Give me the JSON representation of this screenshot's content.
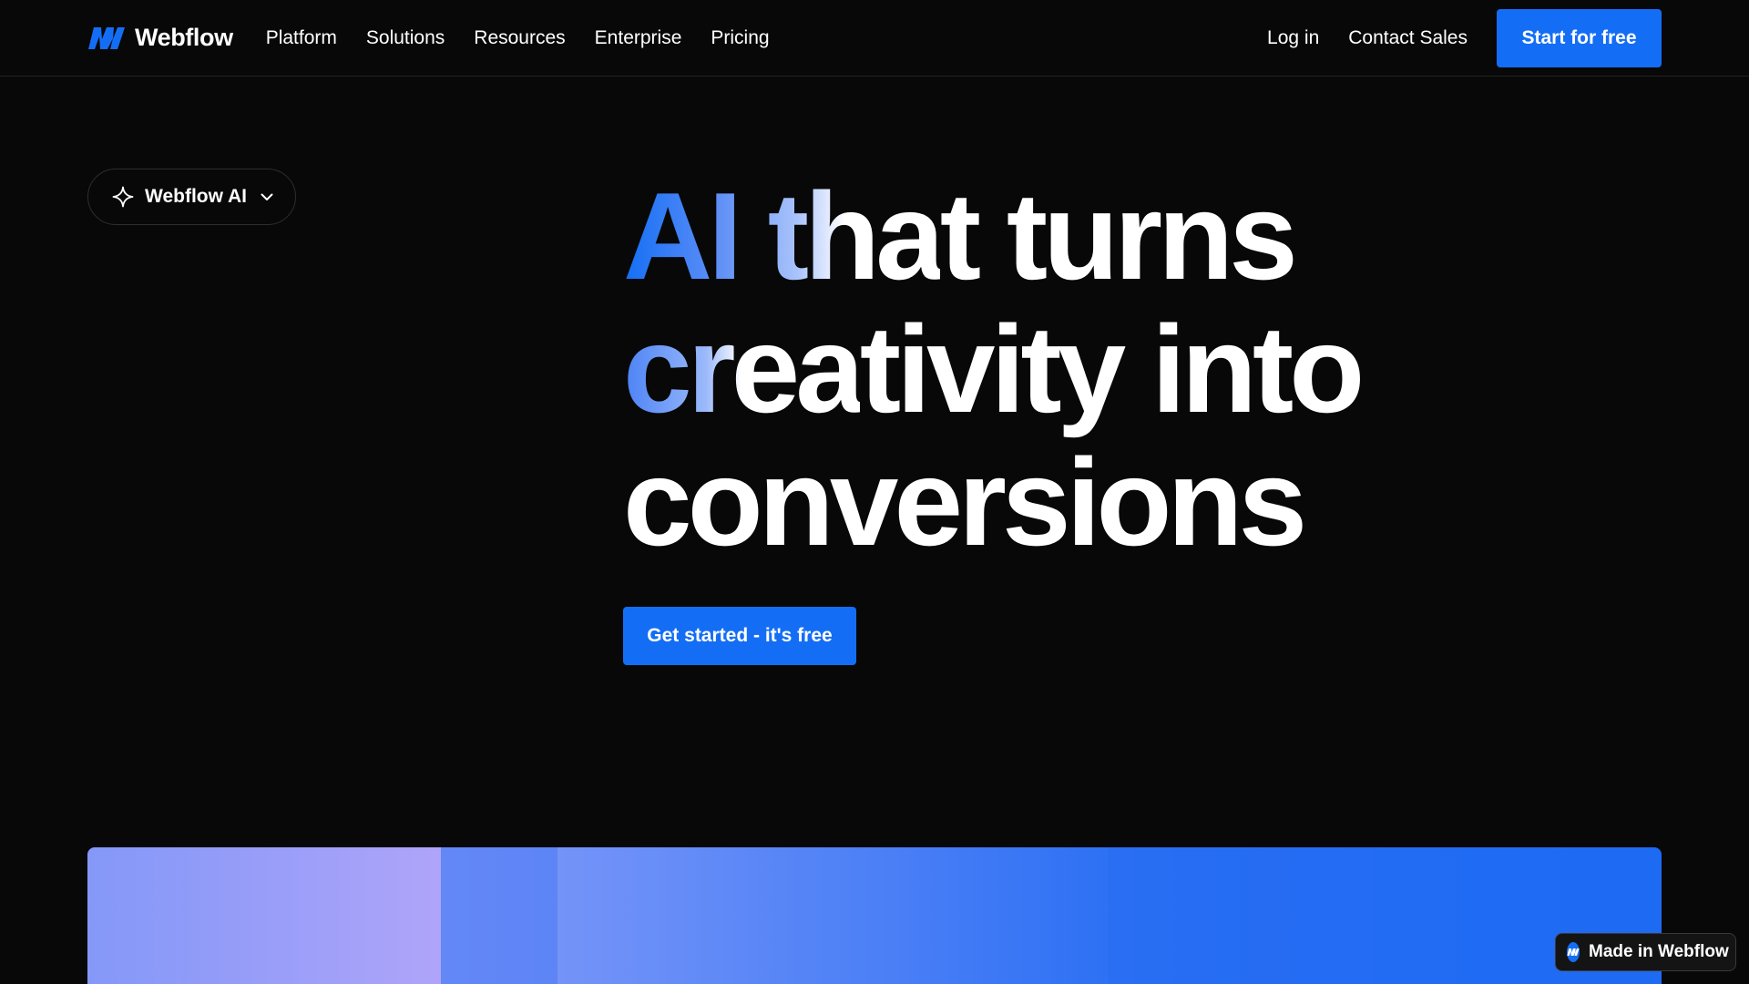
{
  "nav": {
    "brand": "Webflow",
    "links": [
      "Platform",
      "Solutions",
      "Resources",
      "Enterprise",
      "Pricing"
    ],
    "login": "Log in",
    "contact": "Contact Sales",
    "cta": "Start for free"
  },
  "ai_menu": {
    "label": "Webflow AI"
  },
  "hero": {
    "line1_gradient": "AI tha",
    "line1_rest": "t turns",
    "line2_gradient": "crea",
    "line2_rest": "tivity into",
    "line3": "conversions",
    "cta": "Get started - it's free"
  },
  "badge": {
    "label": "Made in Webflow"
  },
  "colors": {
    "background": "#080808",
    "accent": "#146ef5"
  }
}
